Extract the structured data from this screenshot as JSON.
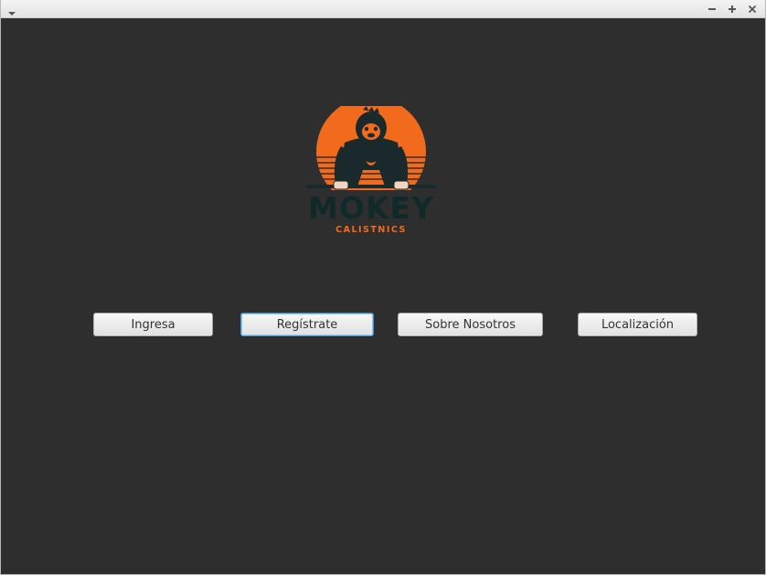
{
  "window": {
    "title": "",
    "controls": {
      "minimize_icon": "minimize-icon",
      "maximize_icon": "maximize-icon",
      "close_icon": "close-icon"
    }
  },
  "logo": {
    "word": "MOKEY",
    "sub": "CALISTNICS",
    "colors": {
      "sun": "#f26b1d",
      "ink": "#102a2a"
    }
  },
  "nav": {
    "ingresa": "Ingresa",
    "registrate": "Regístrate",
    "sobre_nosotros": "Sobre Nosotros",
    "localizacion": "Localización",
    "focused": "Regístrate"
  },
  "colors": {
    "background": "#2e2e2e",
    "focus": "#3a9ad9"
  }
}
